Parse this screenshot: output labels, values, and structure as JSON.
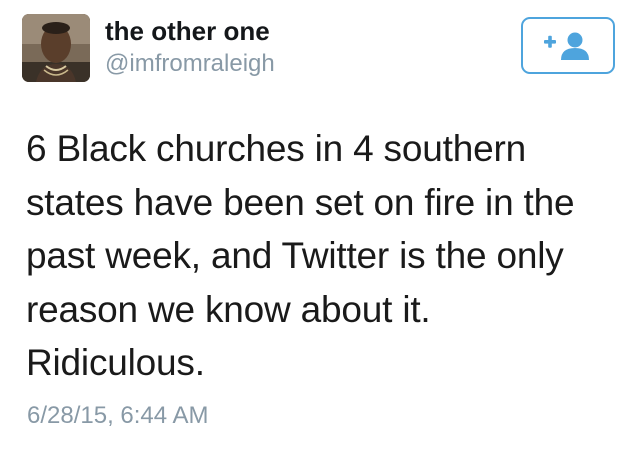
{
  "user": {
    "display_name": "the other one",
    "handle": "@imfromraleigh"
  },
  "follow_button": {
    "icon": "add-user-icon",
    "color": "#4ea4dd"
  },
  "tweet": {
    "text": "6 Black churches in 4 southern states have been set on fire in the past week, and Twitter is the only reason we know about it. Ridiculous.",
    "timestamp": "6/28/15, 6:44 AM"
  },
  "colors": {
    "text": "#14171a",
    "secondary_text": "#8899a6",
    "accent": "#4ea4dd",
    "background": "#ffffff"
  }
}
